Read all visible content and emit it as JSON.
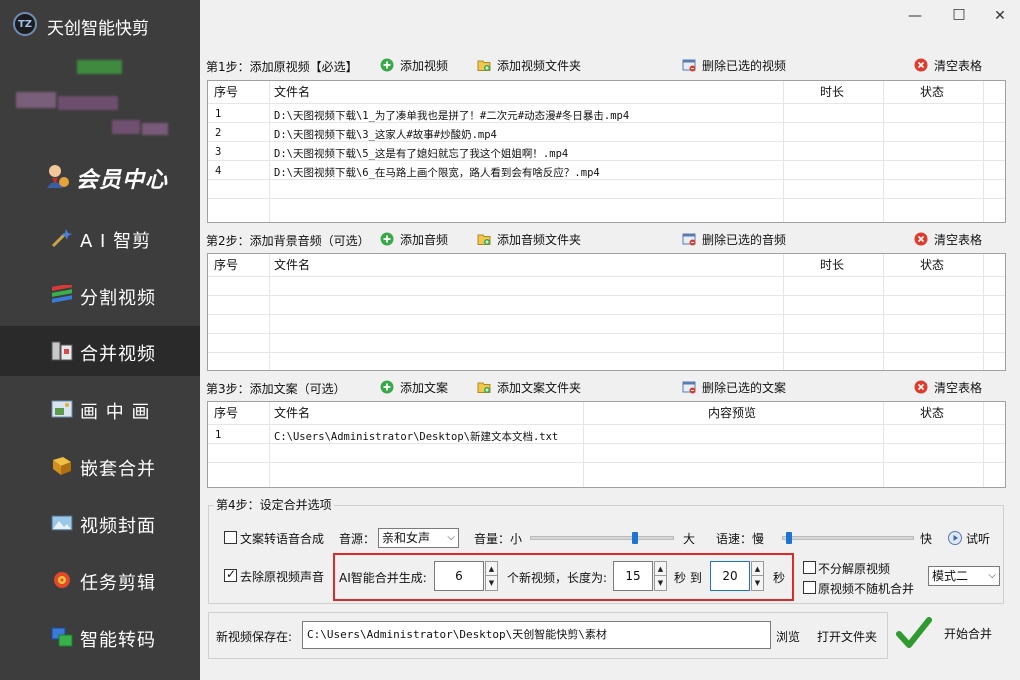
{
  "app": {
    "title": "天创智能快剪",
    "logo_text": "TZ"
  },
  "window_controls": {
    "minimize": "—",
    "maximize": "□",
    "close": "✕"
  },
  "sidebar": {
    "member": {
      "label": "会员中心",
      "icon": "member-avatar-icon"
    },
    "items": [
      {
        "label": "A I 智剪",
        "icon": "ai-magic-icon",
        "active": false
      },
      {
        "label": "分割视频",
        "icon": "split-video-icon",
        "active": false
      },
      {
        "label": "合并视频",
        "icon": "merge-video-icon",
        "active": true
      },
      {
        "label": "画 中 画",
        "icon": "picture-in-picture-icon",
        "active": false
      },
      {
        "label": "嵌套合并",
        "icon": "nested-merge-icon",
        "active": false
      },
      {
        "label": "视频封面",
        "icon": "video-cover-icon",
        "active": false
      },
      {
        "label": "任务剪辑",
        "icon": "task-clip-icon",
        "active": false
      },
      {
        "label": "智能转码",
        "icon": "transcode-icon",
        "active": false
      }
    ]
  },
  "step1": {
    "title": "第1步：添加原视频【必选】",
    "add_btn": "添加视频",
    "add_folder_btn": "添加视频文件夹",
    "delete_btn": "删除已选的视频",
    "clear_btn": "清空表格",
    "columns": [
      "序号",
      "文件名",
      "时长",
      "状态"
    ],
    "rows": [
      [
        "1",
        "D:\\天图视频下载\\1_为了凑单我也是拼了！#二次元#动态漫#冬日暴击.mp4",
        "",
        ""
      ],
      [
        "2",
        "D:\\天图视频下载\\3_这家人#故事#炒酸奶.mp4",
        "",
        ""
      ],
      [
        "3",
        "D:\\天图视频下载\\5_这是有了媳妇就忘了我这个姐姐啊！.mp4",
        "",
        ""
      ],
      [
        "4",
        "D:\\天图视频下载\\6_在马路上画个限宽，路人看到会有啥反应？.mp4",
        "",
        ""
      ]
    ]
  },
  "step2": {
    "title": "第2步：添加背景音频（可选）",
    "add_btn": "添加音频",
    "add_folder_btn": "添加音频文件夹",
    "delete_btn": "删除已选的音频",
    "clear_btn": "清空表格",
    "columns": [
      "序号",
      "文件名",
      "时长",
      "状态"
    ],
    "rows": []
  },
  "step3": {
    "title": "第3步：添加文案（可选）",
    "add_btn": "添加文案",
    "add_folder_btn": "添加文案文件夹",
    "delete_btn": "删除已选的文案",
    "clear_btn": "清空表格",
    "columns": [
      "序号",
      "文件名",
      "内容预览",
      "状态"
    ],
    "rows": [
      [
        "1",
        "C:\\Users\\Administrator\\Desktop\\新建文本文档.txt",
        "",
        ""
      ]
    ]
  },
  "step4": {
    "title": "第4步：设定合并选项",
    "tts_checkbox": {
      "label": "文案转语音合成",
      "checked": false
    },
    "voice_label": "音源：",
    "voice_value": "亲和女声",
    "volume_label": "音量：小",
    "volume_max": "大",
    "volume_level": 0.73,
    "speed_label": "语速：慢",
    "speed_max": "快",
    "speed_level": 0.03,
    "try_listen": "试听",
    "remove_audio_checkbox": {
      "label": "去除原视频声音",
      "checked": true
    },
    "ai_label": "AI智能合并生成:",
    "count_value": "6",
    "new_video_label": "个新视频，长度为:",
    "len_from": "15",
    "sec_to": "秒 到",
    "len_to": "20",
    "sec": "秒",
    "no_split_checkbox": {
      "label": "不分解原视频",
      "checked": false
    },
    "no_random_checkbox": {
      "label": "原视频不随机合并",
      "checked": false
    },
    "mode_value": "模式二"
  },
  "save": {
    "label": "新视频保存在:",
    "path": "C:\\Users\\Administrator\\Desktop\\天创智能快剪\\素材",
    "browse_btn": "浏览",
    "open_folder_btn": "打开文件夹",
    "start_btn": "开始合并"
  }
}
